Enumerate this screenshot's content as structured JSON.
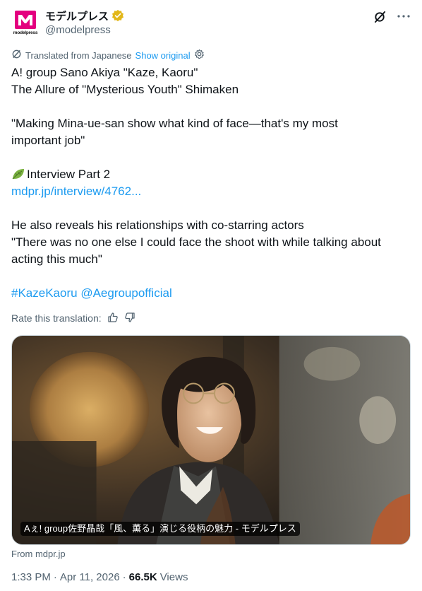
{
  "author": {
    "name": "モデルプレス",
    "handle": "@modelpress",
    "avatar_text": "modelpress",
    "brand_color": "#e4007f",
    "verified_color": "#e2b719"
  },
  "translation": {
    "label": "Translated from Japanese",
    "show_original": "Show original",
    "rate_label": "Rate this translation:"
  },
  "tweet": {
    "line1": "A! group Sano Akiya \"Kaze, Kaoru\"",
    "line2": "The Allure of \"Mysterious Youth\" Shimaken",
    "line3": "\"Making Mina-ue-san show what kind of face—that's my most",
    "line4": "important job\"",
    "line5": "Interview Part 2",
    "link": "mdpr.jp/interview/4762...",
    "line6": "He also reveals his relationships with co-starring actors",
    "line7": "\"There was no one else I could face the shoot with while talking about",
    "line8": "acting this much\"",
    "hashtag": "#KazeKaoru",
    "mention": "@Aegroupofficial"
  },
  "card": {
    "caption": "Aぇ! group佐野晶哉「風、薫る」演じる役柄の魅力 - モデルプレス",
    "source": "From mdpr.jp"
  },
  "meta": {
    "time": "1:33 PM",
    "date": "Apr 11, 2026",
    "separator": "·",
    "views_count": "66.5K",
    "views_label": "Views"
  },
  "icons": [
    "verified-badge-icon",
    "grok-icon",
    "more-icon",
    "translate-icon",
    "settings-icon",
    "leaf-icon",
    "thumbs-up-icon",
    "thumbs-down-icon"
  ]
}
